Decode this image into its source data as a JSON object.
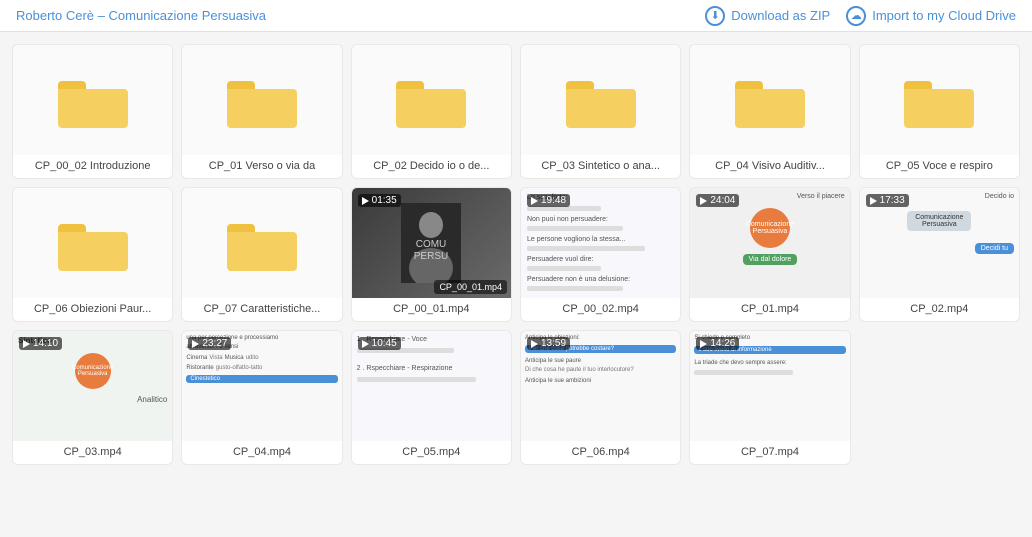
{
  "header": {
    "breadcrumb": "Roberto Cerè – Comunicazione Persuasiva",
    "breadcrumb_author": "Roberto Cerè",
    "breadcrumb_sep": " – ",
    "breadcrumb_title": "Comunicazione Persuasiva",
    "download_label": "Download as ZIP",
    "import_label": "Import to my Cloud Drive"
  },
  "grid": {
    "items": [
      {
        "id": "folder-00-02",
        "type": "folder",
        "label": "CP_00_02 Introduzione"
      },
      {
        "id": "folder-01",
        "type": "folder",
        "label": "CP_01 Verso o via da"
      },
      {
        "id": "folder-02",
        "type": "folder",
        "label": "CP_02 Decido io o de..."
      },
      {
        "id": "folder-03",
        "type": "folder",
        "label": "CP_03 Sintetico o ana..."
      },
      {
        "id": "folder-04",
        "type": "folder",
        "label": "CP_04 Visivo Auditiv..."
      },
      {
        "id": "folder-05",
        "type": "folder",
        "label": "CP_05 Voce e respiro"
      },
      {
        "id": "folder-06",
        "type": "folder",
        "label": "CP_06 Obiezioni Paur..."
      },
      {
        "id": "folder-07",
        "type": "folder",
        "label": "CP_07 Caratteristiche..."
      },
      {
        "id": "video-cp00-01",
        "type": "video",
        "label": "CP_00_01.mp4",
        "duration": "01:35",
        "thumb": "person"
      },
      {
        "id": "video-cp00-02",
        "type": "video",
        "label": "CP_00_02.mp4",
        "duration": "19:48",
        "thumb": "slide1"
      },
      {
        "id": "video-cp01",
        "type": "video",
        "label": "CP_01.mp4",
        "duration": "24:04",
        "thumb": "slide2"
      },
      {
        "id": "video-cp02",
        "type": "video",
        "label": "CP_02.mp4",
        "duration": "17:33",
        "thumb": "slide3"
      },
      {
        "id": "video-cp03",
        "type": "video",
        "label": "CP_03.mp4",
        "duration": "14:10",
        "thumb": "slide4"
      },
      {
        "id": "video-cp04",
        "type": "video",
        "label": "CP_04.mp4",
        "duration": "23:27",
        "thumb": "slide5"
      },
      {
        "id": "video-cp05",
        "type": "video",
        "label": "CP_05.mp4",
        "duration": "10:45",
        "thumb": "slide6"
      },
      {
        "id": "video-cp06",
        "type": "video",
        "label": "CP_06.mp4",
        "duration": "13:59",
        "thumb": "slide7"
      },
      {
        "id": "video-cp07",
        "type": "video",
        "label": "CP_07.mp4",
        "duration": "14:26",
        "thumb": "slide8"
      }
    ]
  }
}
